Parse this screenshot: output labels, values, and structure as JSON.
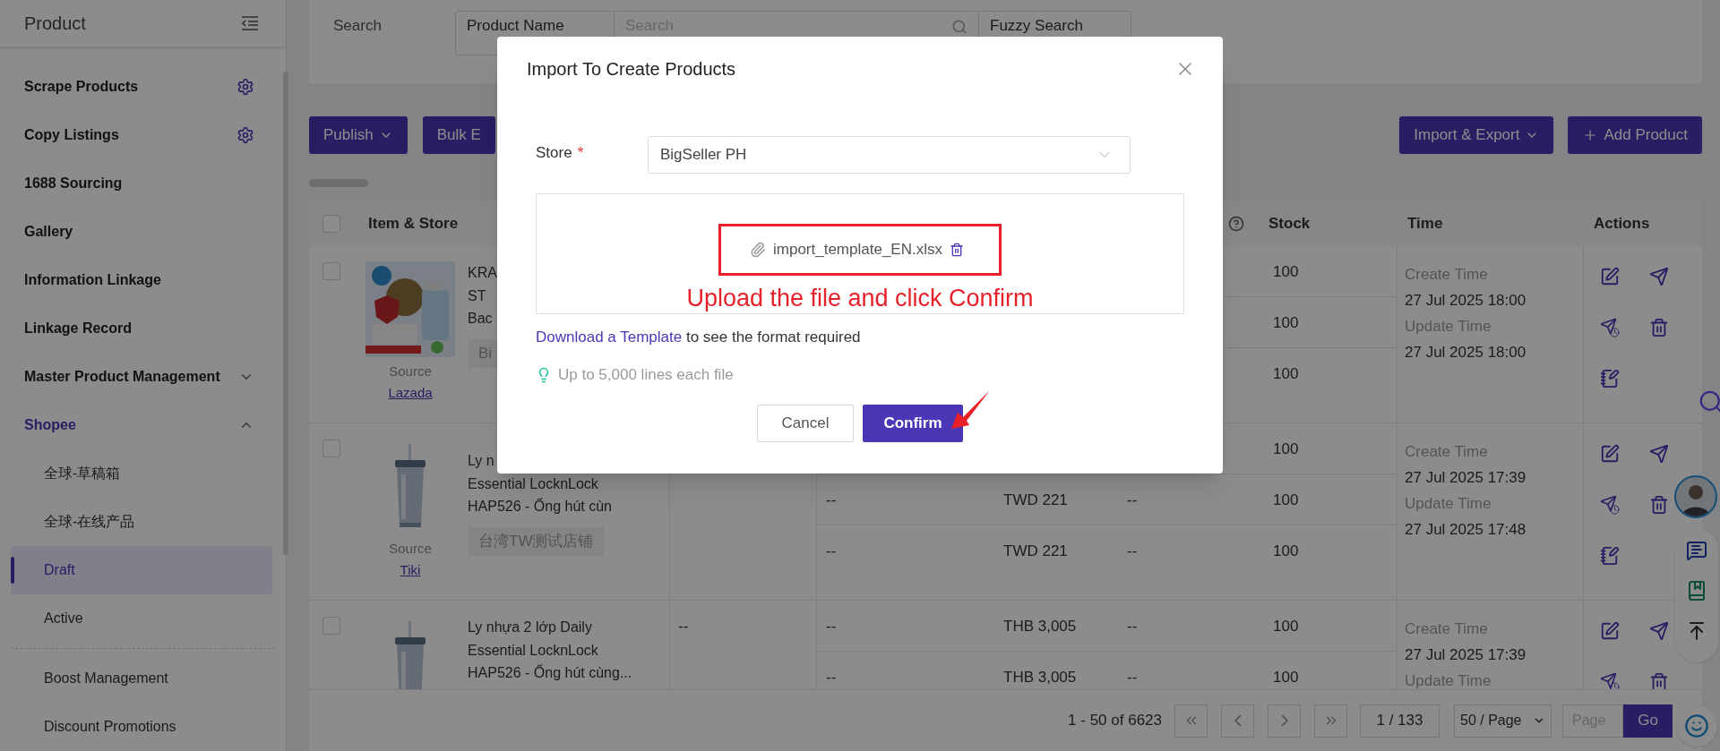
{
  "sidebar": {
    "title": "Product",
    "items": [
      {
        "label": "Scrape Products",
        "kind": "settings",
        "selected": false
      },
      {
        "label": "Copy Listings",
        "kind": "settings",
        "selected": false
      },
      {
        "label": "1688 Sourcing",
        "kind": "link",
        "selected": false
      },
      {
        "label": "Gallery",
        "kind": "link",
        "selected": false
      },
      {
        "label": "Information Linkage",
        "kind": "link",
        "selected": false
      },
      {
        "label": "Linkage Record",
        "kind": "link",
        "selected": false
      },
      {
        "label": "Master Product Management",
        "kind": "group",
        "selected": false,
        "expanded": false
      },
      {
        "label": "Shopee",
        "kind": "group",
        "selected": true,
        "expanded": true,
        "children": [
          {
            "label": "全球-草稿箱",
            "selected": false,
            "divider_before": false
          },
          {
            "label": "全球-在线产品",
            "selected": false,
            "divider_before": false
          },
          {
            "label": "Draft",
            "selected": true,
            "divider_before": false
          },
          {
            "label": "Active",
            "selected": false,
            "divider_before": false
          },
          {
            "label": "Boost Management",
            "selected": false,
            "divider_before": true
          },
          {
            "label": "Discount Promotions",
            "selected": false,
            "divider_before": false
          }
        ]
      }
    ]
  },
  "search": {
    "label": "Search",
    "field": "Product Name",
    "placeholder": "Search",
    "mode": "Fuzzy Search"
  },
  "toolbar": {
    "left": [
      {
        "label": "Publish",
        "kind": "menu"
      },
      {
        "label": "Bulk E",
        "kind": "plain"
      }
    ],
    "right": [
      {
        "label": "Import & Export",
        "kind": "menu"
      },
      {
        "label": "Add Product",
        "kind": "add"
      }
    ]
  },
  "table": {
    "all_checked": false,
    "help_icon": true,
    "columns": [
      {
        "label": "Item & Store"
      },
      {
        "label": "Stock"
      },
      {
        "label": "Time"
      },
      {
        "label": "Actions"
      }
    ],
    "rows": [
      {
        "checked": false,
        "picture": {
          "kind": "picture"
        },
        "title_lines": [
          "KRA",
          "ST",
          "Bac"
        ],
        "store": "Bi",
        "source_label": "Source",
        "source": "Lazada",
        "variants": [
          {
            "stock": "100"
          },
          {
            "stock": "100"
          },
          {
            "stock": "100"
          }
        ],
        "times": [
          {
            "label": "Create Time",
            "value": "27 Jul 2025 18:00"
          },
          {
            "label": "Update Time",
            "value": "27 Jul 2025 18:00"
          }
        ],
        "actions": [
          {
            "kind": "edit"
          },
          {
            "kind": "send"
          },
          {
            "kind": "schedule-send"
          },
          {
            "kind": "delete"
          },
          {
            "kind": "note"
          }
        ]
      },
      {
        "checked": false,
        "picture": {
          "kind": "picture"
        },
        "title_lines": [
          "Ly n",
          "Essential LocknLock",
          "HAP526 - Ống hút cùn"
        ],
        "store": "台湾TW测试店铺",
        "source_label": "Source",
        "source": "Tiki",
        "variants": [
          {
            "stock": "100"
          },
          {
            "column_4": "--",
            "price": "TWD 221",
            "column_6": "--",
            "stock": "100"
          },
          {
            "column_4": "--",
            "price": "TWD 221",
            "column_6": "--",
            "stock": "100"
          }
        ],
        "times": [
          {
            "label": "Create Time",
            "value": "27 Jul 2025 17:39"
          },
          {
            "label": "Update Time",
            "value": "27 Jul 2025 17:48"
          }
        ],
        "actions": [
          {
            "kind": "edit"
          },
          {
            "kind": "send"
          },
          {
            "kind": "schedule-send"
          },
          {
            "kind": "delete"
          },
          {
            "kind": "note"
          }
        ]
      },
      {
        "checked": false,
        "picture": {
          "kind": "picture"
        },
        "title_lines": [
          "Ly nhựa 2 lớp Daily",
          "Essential LocknLock",
          "HAP526 - Ống hút cùng..."
        ],
        "column_3": "--",
        "variants": [
          {
            "column_4": "--",
            "price": "THB 3,005",
            "column_6": "--",
            "stock": "100"
          },
          {
            "column_4": "--",
            "price": "THB 3,005",
            "column_6": "--",
            "stock": "100"
          }
        ],
        "times": [
          {
            "label": "Create Time",
            "value": "27 Jul 2025 17:39"
          },
          {
            "label": "Update Time"
          }
        ],
        "actions": [
          {
            "kind": "edit"
          },
          {
            "kind": "send"
          },
          {
            "kind": "schedule-send"
          },
          {
            "kind": "delete"
          }
        ]
      }
    ]
  },
  "pagination": {
    "summary": "1 - 50 of 6623",
    "page": "1 / 133",
    "page_size": "50 / Page",
    "jump_placeholder": "Page",
    "go": "Go"
  },
  "dialog": {
    "title": "Import To Create Products",
    "store_label": "Store",
    "required_mark": "*",
    "store_value": "BigSeller PH",
    "file_name": "import_template_EN.xlsx",
    "link": "Download a Template",
    "link_suffix": " to see the format required",
    "tip": "Up to 5,000 lines each file",
    "buttons": [
      {
        "label": "Cancel",
        "kind": "secondary"
      },
      {
        "label": "Confirm",
        "kind": "primary"
      }
    ]
  },
  "annotation": {
    "text": "Upload the file and click Confirm"
  }
}
